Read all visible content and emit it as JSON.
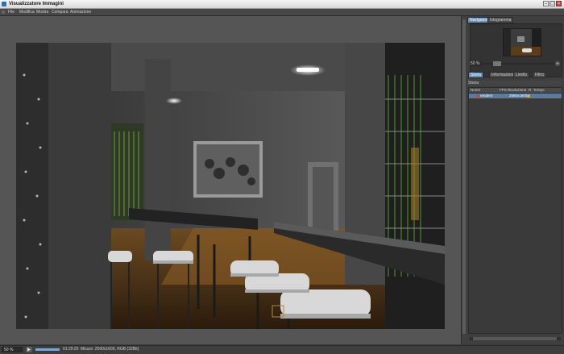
{
  "window": {
    "title": "Visualizzatore Immagini",
    "minimize": "–",
    "maximize": "□",
    "close": "×"
  },
  "menu": [
    "File",
    "Modifica",
    "Mostra",
    "Compara",
    "Animazione"
  ],
  "right_panel": {
    "tabs": [
      "Navigatore",
      "Istogramma"
    ],
    "zoom_value": "50 %",
    "zoom_plus": "+",
    "section_tabs": [
      "Storia",
      "Informazioni",
      "Livello",
      "Filtro"
    ],
    "history_title": "Storia",
    "columns": [
      "Nome",
      "FPS",
      "Risoluzione",
      "R",
      "Tempo Rendering"
    ],
    "rows": [
      {
        "name": "render4",
        "resolution": "2560x1600"
      }
    ]
  },
  "statusbar": {
    "zoom": "50 %",
    "progress": 1.0,
    "time": "01:29:20",
    "info": "Misure: 2560x1600, RGB (32Bit)"
  },
  "colors": {
    "accent": "#6b8fb5",
    "selection": "#5b7a9c"
  }
}
